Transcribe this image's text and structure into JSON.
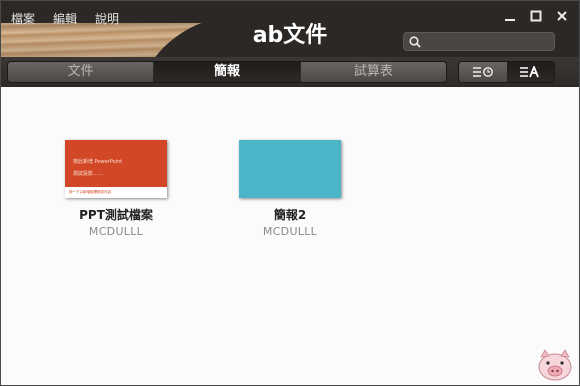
{
  "menu": [
    "檔案",
    "編輯",
    "說明"
  ],
  "app_title": "ab文件",
  "search": {
    "placeholder": ""
  },
  "tabs": [
    {
      "label": "文件",
      "active": false
    },
    {
      "label": "簡報",
      "active": true
    },
    {
      "label": "試算表",
      "active": false
    }
  ],
  "view_toggle": {
    "selected": "sort-by-name"
  },
  "files": [
    {
      "name": "PPT測試檔案",
      "author": "MCDULLL",
      "thumb": {
        "type": "ppt",
        "line1": "按此新增 PowerPoint",
        "line2": "測試投影……",
        "footer": "按一下以新增副標題或內容"
      }
    },
    {
      "name": "簡報2",
      "author": "MCDULLL",
      "thumb": {
        "type": "blue"
      }
    }
  ],
  "colors": {
    "accent_ppt": "#d24726",
    "thumb_blue": "#4bb5c8",
    "header_dark": "#2c2826"
  }
}
